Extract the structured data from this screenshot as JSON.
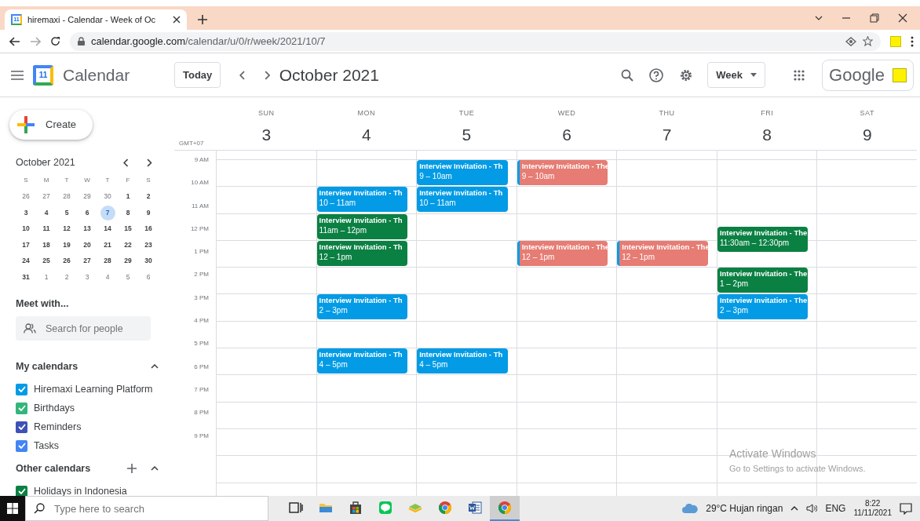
{
  "browser": {
    "tab_title": "hiremaxi - Calendar - Week of Oc",
    "favicon_day": "11",
    "url_host": "calendar.google.com",
    "url_path": "/calendar/u/0/r/week/2021/10/7"
  },
  "header": {
    "logo_day": "11",
    "app_name": "Calendar",
    "today_button": "Today",
    "period": "October 2021",
    "view": "Week",
    "account_label": "Google"
  },
  "sidebar": {
    "create": "Create",
    "mini_calendar": {
      "title": "October 2021",
      "weekdays": [
        "S",
        "M",
        "T",
        "W",
        "T",
        "F",
        "S"
      ],
      "weeks": [
        [
          {
            "day": "26",
            "in_month": false,
            "selected": false
          },
          {
            "day": "27",
            "in_month": false,
            "selected": false
          },
          {
            "day": "28",
            "in_month": false,
            "selected": false
          },
          {
            "day": "29",
            "in_month": false,
            "selected": false
          },
          {
            "day": "30",
            "in_month": false,
            "selected": false
          },
          {
            "day": "1",
            "in_month": true,
            "selected": false
          },
          {
            "day": "2",
            "in_month": true,
            "selected": false
          }
        ],
        [
          {
            "day": "3",
            "in_month": true,
            "selected": false
          },
          {
            "day": "4",
            "in_month": true,
            "selected": false
          },
          {
            "day": "5",
            "in_month": true,
            "selected": false
          },
          {
            "day": "6",
            "in_month": true,
            "selected": false
          },
          {
            "day": "7",
            "in_month": true,
            "selected": true
          },
          {
            "day": "8",
            "in_month": true,
            "selected": false
          },
          {
            "day": "9",
            "in_month": true,
            "selected": false
          }
        ],
        [
          {
            "day": "10",
            "in_month": true,
            "selected": false
          },
          {
            "day": "11",
            "in_month": true,
            "selected": false
          },
          {
            "day": "12",
            "in_month": true,
            "selected": false
          },
          {
            "day": "13",
            "in_month": true,
            "selected": false
          },
          {
            "day": "14",
            "in_month": true,
            "selected": false
          },
          {
            "day": "15",
            "in_month": true,
            "selected": false
          },
          {
            "day": "16",
            "in_month": true,
            "selected": false
          }
        ],
        [
          {
            "day": "17",
            "in_month": true,
            "selected": false
          },
          {
            "day": "18",
            "in_month": true,
            "selected": false
          },
          {
            "day": "19",
            "in_month": true,
            "selected": false
          },
          {
            "day": "20",
            "in_month": true,
            "selected": false
          },
          {
            "day": "21",
            "in_month": true,
            "selected": false
          },
          {
            "day": "22",
            "in_month": true,
            "selected": false
          },
          {
            "day": "23",
            "in_month": true,
            "selected": false
          }
        ],
        [
          {
            "day": "24",
            "in_month": true,
            "selected": false
          },
          {
            "day": "25",
            "in_month": true,
            "selected": false
          },
          {
            "day": "26",
            "in_month": true,
            "selected": false
          },
          {
            "day": "27",
            "in_month": true,
            "selected": false
          },
          {
            "day": "28",
            "in_month": true,
            "selected": false
          },
          {
            "day": "29",
            "in_month": true,
            "selected": false
          },
          {
            "day": "30",
            "in_month": true,
            "selected": false
          }
        ],
        [
          {
            "day": "31",
            "in_month": true,
            "selected": false
          },
          {
            "day": "1",
            "in_month": false,
            "selected": false
          },
          {
            "day": "2",
            "in_month": false,
            "selected": false
          },
          {
            "day": "3",
            "in_month": false,
            "selected": false
          },
          {
            "day": "4",
            "in_month": false,
            "selected": false
          },
          {
            "day": "5",
            "in_month": false,
            "selected": false
          },
          {
            "day": "6",
            "in_month": false,
            "selected": false
          }
        ]
      ]
    },
    "meet_with": {
      "title": "Meet with...",
      "placeholder": "Search for people"
    },
    "my_calendars": {
      "title": "My calendars",
      "expanded": true,
      "items": [
        {
          "name": "Hiremaxi Learning Platform",
          "color": "#039be5",
          "checked": true
        },
        {
          "name": "Birthdays",
          "color": "#33b679",
          "checked": true
        },
        {
          "name": "Reminders",
          "color": "#3f51b5",
          "checked": true
        },
        {
          "name": "Tasks",
          "color": "#4285f4",
          "checked": true
        }
      ]
    },
    "other_calendars": {
      "title": "Other calendars",
      "expanded": true,
      "items": [
        {
          "name": "Holidays in Indonesia",
          "color": "#0b8043",
          "checked": true
        }
      ]
    }
  },
  "week": {
    "timezone": "GMT+07",
    "hour_labels": [
      "9 AM",
      "10 AM",
      "11 AM",
      "12 PM",
      "1 PM",
      "2 PM",
      "3 PM",
      "4 PM",
      "5 PM",
      "6 PM",
      "7 PM",
      "8 PM",
      "9 PM"
    ],
    "days": [
      {
        "weekday": "SUN",
        "date": "3"
      },
      {
        "weekday": "MON",
        "date": "4",
        "slots": [
          {
            "busy": false
          },
          {
            "busy": true,
            "title": "Interview Invitation - Th",
            "time": "10 – 11am",
            "color": "#039be5"
          },
          {
            "busy": true,
            "title": "Interview Invitation - Th",
            "time": "11am – 12pm",
            "color": "#0b8043"
          },
          {
            "busy": true,
            "title": "Interview Invitation - Th",
            "time": "12 – 1pm",
            "color": "#0b8043"
          },
          {
            "busy": false
          },
          {
            "busy": true,
            "title": "Interview Invitation - Th",
            "time": "2 – 3pm",
            "color": "#039be5"
          },
          {
            "busy": false
          },
          {
            "busy": true,
            "title": "Interview Invitation - Th",
            "time": "4 – 5pm",
            "color": "#039be5"
          }
        ]
      },
      {
        "weekday": "TUE",
        "date": "5",
        "slots": [
          {
            "busy": true,
            "title": "Interview Invitation - Th",
            "time": "9 – 10am",
            "color": "#039be5"
          },
          {
            "busy": true,
            "title": "Interview Invitation - Th",
            "time": "10 – 11am",
            "color": "#039be5"
          },
          {
            "busy": false
          },
          {
            "busy": false
          },
          {
            "busy": false
          },
          {
            "busy": false
          },
          {
            "busy": false
          },
          {
            "busy": true,
            "title": "Interview Invitation - Th",
            "time": "4 – 5pm",
            "color": "#039be5"
          }
        ]
      },
      {
        "weekday": "WED",
        "date": "6",
        "slots": [
          {
            "busy": true,
            "title": "Interview Invitation - The",
            "time": "9 – 10am",
            "color": "#e67c73",
            "stripe": {
              "color": "#039be5"
            }
          },
          {
            "busy": false
          },
          {
            "busy": false
          },
          {
            "busy": true,
            "title": "Interview Invitation - The",
            "time": "12 – 1pm",
            "color": "#e67c73",
            "stripe": {
              "color": "#039be5"
            }
          }
        ]
      },
      {
        "weekday": "THU",
        "date": "7",
        "slots": [
          {
            "busy": false
          },
          {
            "busy": false
          },
          {
            "busy": false
          },
          {
            "busy": true,
            "title": "Interview Invitation - The",
            "time": "12 – 1pm",
            "color": "#e67c73",
            "stripe": {
              "color": "#039be5"
            }
          }
        ]
      },
      {
        "weekday": "FRI",
        "date": "8",
        "slots": [
          {
            "busy": false
          },
          {
            "busy": false
          },
          {
            "busy": true,
            "title": "Interview Invitation - The",
            "time": "11:30am – 12:30pm",
            "color": "#0b8043",
            "half_past": true
          },
          {
            "busy": false
          },
          {
            "busy": true,
            "title": "Interview Invitation - The",
            "time": "1 – 2pm",
            "color": "#0b8043"
          },
          {
            "busy": true,
            "title": "Interview Invitation - The",
            "time": "2 – 3pm",
            "color": "#039be5"
          }
        ]
      },
      {
        "weekday": "SAT",
        "date": "9"
      }
    ]
  },
  "activation_notice": {
    "title": "Activate Windows",
    "subtitle": "Go to Settings to activate Windows."
  },
  "taskbar": {
    "search_placeholder": "Type here to search",
    "apps": [
      {
        "kind": "task-view",
        "active": false
      },
      {
        "kind": "folder",
        "active": false
      },
      {
        "kind": "store",
        "active": false
      },
      {
        "kind": "chat",
        "active": false
      },
      {
        "kind": "layers",
        "active": false
      },
      {
        "kind": "browser",
        "active": false
      },
      {
        "kind": "word",
        "active": false
      },
      {
        "kind": "browser",
        "active": true
      }
    ],
    "weather": "29°C Hujan ringan",
    "language": "ENG",
    "time": "8:22",
    "date": "11/11/2021"
  }
}
